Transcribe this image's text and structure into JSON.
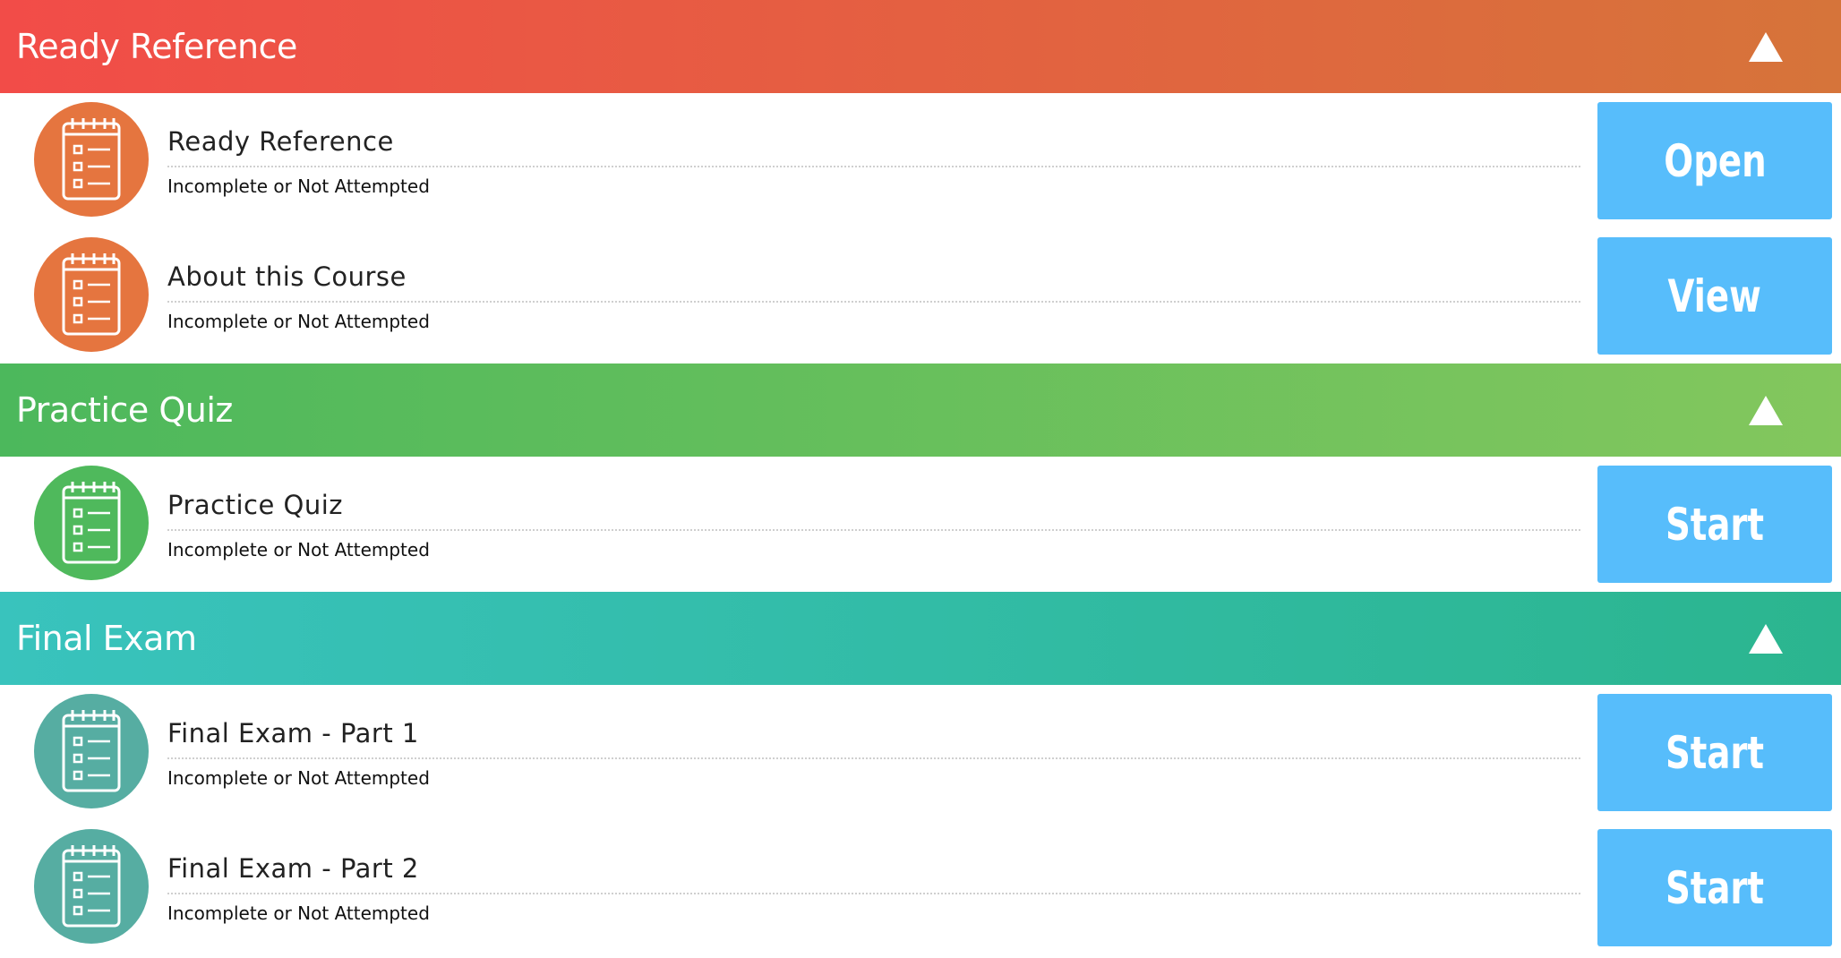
{
  "sections": [
    {
      "title": "Ready Reference",
      "gradient_start": "#f24c48",
      "gradient_end": "#d6743a",
      "icon_color": "#e5753f",
      "items": [
        {
          "title": "Ready Reference",
          "status": "Incomplete or Not Attempted",
          "button": "Open",
          "icon": "checklist-icon"
        },
        {
          "title": "About this Course",
          "status": "Incomplete or Not Attempted",
          "button": "View",
          "icon": "checklist-icon"
        }
      ]
    },
    {
      "title": "Practice Quiz",
      "gradient_start": "#4cb85c",
      "gradient_end": "#83c75d",
      "icon_color": "#4fb95c",
      "items": [
        {
          "title": "Practice Quiz",
          "status": "Incomplete or Not Attempted",
          "button": "Start",
          "icon": "checklist-icon"
        }
      ]
    },
    {
      "title": "Final Exam",
      "gradient_start": "#39c3bd",
      "gradient_end": "#2bb58f",
      "icon_color": "#56ada2",
      "items": [
        {
          "title": "Final Exam - Part 1",
          "status": "Incomplete or Not Attempted",
          "button": "Start",
          "icon": "checklist-icon"
        },
        {
          "title": "Final Exam - Part 2",
          "status": "Incomplete or Not Attempted",
          "button": "Start",
          "icon": "checklist-icon"
        }
      ]
    }
  ],
  "button_color": "#57bdfb",
  "toggle_icon": "triangle-up-icon"
}
